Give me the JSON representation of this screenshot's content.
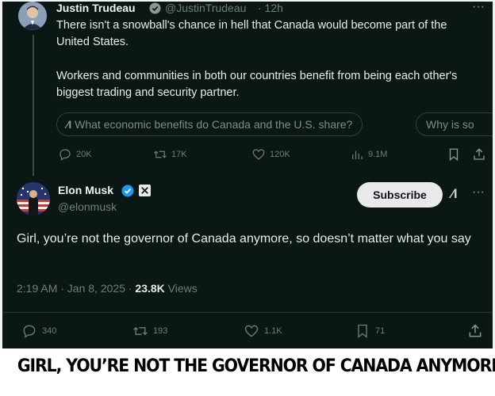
{
  "tweet1": {
    "name": "Justin Trudeau",
    "handle": "@JustinTrudeau",
    "time": "· 12h",
    "text_p1": "There isn't a snowball's chance in hell that Canada would become part of the United States.",
    "text_p2": "Workers and communities in both our countries benefit from being each other's biggest trading and security partner.",
    "grok_prompt_1": "What economic benefits do Canada and the U.S. share?",
    "grok_prompt_2": "Why is so",
    "stats": {
      "replies": "20K",
      "reposts": "17K",
      "likes": "120K",
      "views": "9.1M"
    }
  },
  "tweet2": {
    "name": "Elon Musk",
    "handle": "@elonmusk",
    "subscribe_label": "Subscribe",
    "text": "Girl, you’re not the governor of Canada anymore, so doesn’t matter what you say",
    "time": "2:19 AM · Jan 8, 2025 ·",
    "views_count": "23.8K",
    "views_label": "Views",
    "stats": {
      "replies": "340",
      "reposts": "193",
      "likes": "1.1K",
      "bookmarks": "71"
    }
  },
  "caption": "GIRL, YOU’RE NOT THE GOVERNOR OF CANADA ANYMORE",
  "colors": {
    "background": "#0a1714",
    "verified": "#1d9bf0",
    "text": "#e7e9ea",
    "muted": "#6f7f7b"
  },
  "icons": [
    "verified-badge-icon",
    "x-logo-icon",
    "grok-icon",
    "more-icon",
    "reply-icon",
    "repost-icon",
    "like-icon",
    "views-icon",
    "bookmark-icon",
    "share-icon"
  ]
}
